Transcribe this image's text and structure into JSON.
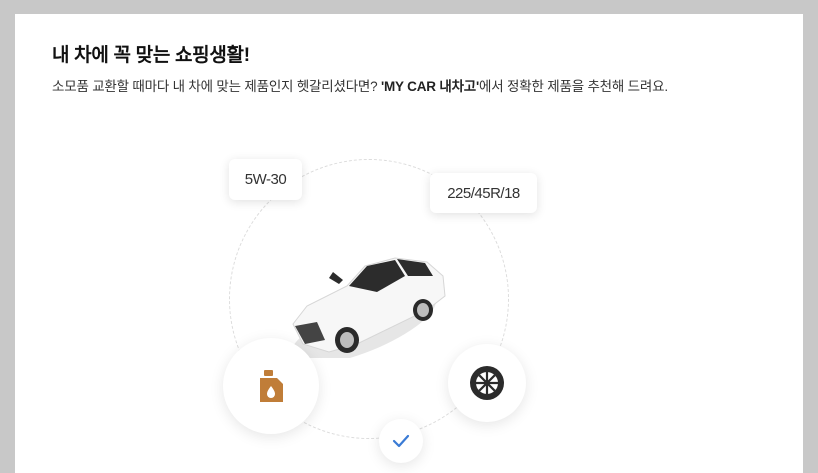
{
  "header": {
    "title": "내 차에 꼭 맞는 쇼핑생활!",
    "desc_part1": "소모품 교환할 때마다 내 차에 맞는 제품인지 헷갈리셨다면? ",
    "desc_brand": "'MY CAR 내차고'",
    "desc_part2": "에서 정확한 제품을 추천해 드려요."
  },
  "illustration": {
    "oil_tag": "5W-30",
    "tire_tag": "225/45R/18",
    "icons": [
      "car-illustration",
      "oil-can-icon",
      "tire-icon",
      "check-icon"
    ],
    "colors": {
      "oil_can": "#c07d38",
      "tire": "#2b2b2b",
      "check": "#3a7bd5",
      "orbit": "#dcdcdc"
    }
  }
}
